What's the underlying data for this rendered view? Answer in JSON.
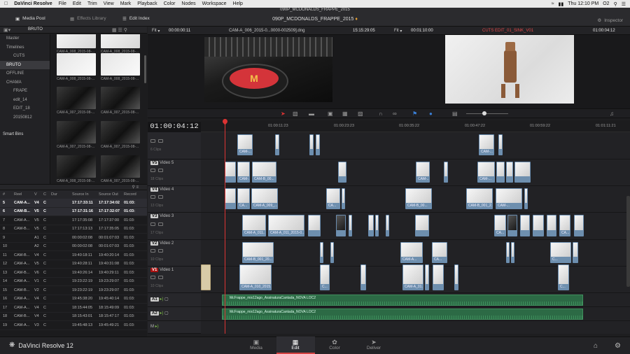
{
  "menubar": {
    "app": "DaVinci Resolve",
    "items": [
      "File",
      "Edit",
      "Trim",
      "View",
      "Mark",
      "Playback",
      "Color",
      "Nodes",
      "Workspace",
      "Help"
    ],
    "right": {
      "clock": "Thu 12:10 PM",
      "user": "O2"
    }
  },
  "window_title": "090P_MCDONALDS_FRAPPE_2015",
  "topbar": {
    "media_pool": "Media Pool",
    "effects_library": "Effects Library",
    "edit_index": "Edit Index",
    "project_title": "090P_MCDONALDS_FRAPPE_2015",
    "inspector": "Inspector",
    "bin_label": "BRUTO"
  },
  "bins": [
    {
      "label": "Master",
      "selected": false,
      "indent": false
    },
    {
      "label": "Timelines",
      "selected": false,
      "indent": false
    },
    {
      "label": "CUTS",
      "selected": false,
      "indent": true
    },
    {
      "label": "BRUTO",
      "selected": true,
      "indent": false
    },
    {
      "label": "OFFLINE",
      "selected": false,
      "indent": false
    },
    {
      "label": "CHAMA",
      "selected": false,
      "indent": false
    },
    {
      "label": "FRAPE",
      "selected": false,
      "indent": true
    },
    {
      "label": "edit_14",
      "selected": false,
      "indent": true
    },
    {
      "label": "EDIT_18",
      "selected": false,
      "indent": true
    },
    {
      "label": "20150812",
      "selected": false,
      "indent": true
    }
  ],
  "smart_bins": "Smart Bins",
  "thumbs": [
    {
      "caption": "CAM-A_008_2015-08-...",
      "style": "white"
    },
    {
      "caption": "CAM-A_008_2015-08-...",
      "style": "white"
    },
    {
      "caption": "CAM-A_008_2015-08-...",
      "style": "white2"
    },
    {
      "caption": "CAM-A_008_2015-08-...",
      "style": "white2"
    },
    {
      "caption": "CAM-A_007_2015-08-...",
      "style": "dj"
    },
    {
      "caption": "CAM-A_007_2015-08-...",
      "style": "dj"
    },
    {
      "caption": "CAM-A_007_2015-08-...",
      "style": "dj"
    },
    {
      "caption": "CAM-A_007_2015-08-...",
      "style": "dj"
    },
    {
      "caption": "CAM-A_008_2015-08-...",
      "style": "dj"
    },
    {
      "caption": "CAM-A_007_2015-08-...",
      "style": "dj"
    }
  ],
  "table": {
    "headers": [
      "#",
      "Reel",
      "V",
      "C",
      "Dur",
      "Source In",
      "Source Out",
      "Record"
    ],
    "rows": [
      [
        "5",
        "CAM-A...",
        "V4",
        "C",
        "",
        "17:17:33:11",
        "17:17:34:02",
        "01:03:",
        true
      ],
      [
        "6",
        "CAM-B...",
        "V5",
        "C",
        "",
        "17:17:31:16",
        "17:17:32:07",
        "01:03:",
        true
      ],
      [
        "7",
        "CAM-A...",
        "V5",
        "C",
        "",
        "17:17:35:08",
        "17:17:37:00",
        "01:03:",
        false
      ],
      [
        "8",
        "CAM-B...",
        "V5",
        "C",
        "",
        "17:17:13:13",
        "17:17:35:05",
        "01:03:",
        false
      ],
      [
        "9",
        "",
        "A1",
        "C",
        "",
        "00:00:02:08",
        "00:01:07:03",
        "01:03:",
        false
      ],
      [
        "10",
        "",
        "A2",
        "C",
        "",
        "00:00:02:08",
        "00:01:07:03",
        "01:03:",
        false
      ],
      [
        "11",
        "CAM-B...",
        "V4",
        "C",
        "",
        "19:40:18:11",
        "19:40:20:14",
        "01:03:",
        false
      ],
      [
        "12",
        "CAM-A...",
        "V5",
        "C",
        "",
        "19:40:28:11",
        "19:40:31:08",
        "01:03:",
        false
      ],
      [
        "13",
        "CAM-B...",
        "V6",
        "C",
        "",
        "19:40:26:14",
        "19:40:29:11",
        "01:03:",
        false
      ],
      [
        "14",
        "CAM-A...",
        "V1",
        "C",
        "",
        "19:23:22:19",
        "19:23:29:07",
        "01:03:",
        false
      ],
      [
        "15",
        "CAM-B...",
        "V2",
        "C",
        "",
        "19:23:22:19",
        "19:23:29:07",
        "01:03:",
        false
      ],
      [
        "16",
        "CAM-A...",
        "V4",
        "C",
        "",
        "19:45:38:20",
        "19:45:40:14",
        "01:03:",
        false
      ],
      [
        "17",
        "CAM-A...",
        "V4",
        "C",
        "",
        "18:15:44:05",
        "18:15:49:09",
        "01:03:",
        false
      ],
      [
        "18",
        "CAM-B...",
        "V4",
        "C",
        "",
        "18:15:43:01",
        "18:15:47:17",
        "01:03:",
        false
      ],
      [
        "19",
        "CAM-A...",
        "V3",
        "C",
        "",
        "19:45:48:13",
        "19:45:49:21",
        "01:03:",
        false
      ]
    ]
  },
  "source_viewer": {
    "fit": "Fit",
    "timecode_left": "00:00:00:11",
    "clip_name": "CAM-A_006_2015-0...0000-002509].dng",
    "timecode_right": "15:15:29:05"
  },
  "record_viewer": {
    "fit": "Fit",
    "timecode_left": "00:01:10:00",
    "timeline_name": "CUTS EDIT_01_SINK_V01",
    "timecode_right": "01:00:04:12"
  },
  "timeline": {
    "timecode": "01:00:04:12",
    "ruler": [
      "01:00:11:23",
      "01:00:23:23",
      "01:00:35:22",
      "01:00:47:22",
      "01:00:59:22",
      "01:01:11:21"
    ]
  },
  "tracks": {
    "v6": {
      "count": "6 Clips"
    },
    "v5": {
      "name": "Video 5",
      "badge": "V5",
      "count": "18 Clips"
    },
    "v4": {
      "name": "Video 4",
      "badge": "V4",
      "count": "13 Clips"
    },
    "v3": {
      "name": "Video 3",
      "badge": "V3",
      "count": "17 Clips"
    },
    "v2": {
      "name": "Video 2",
      "badge": "V2",
      "count": "10 Clips"
    },
    "v1": {
      "name": "Video 1",
      "badge": "V1",
      "count": "10 Clips"
    },
    "a1": {
      "badge": "A1"
    },
    "a2": {
      "badge": "A2"
    },
    "m": {
      "badge": "M"
    }
  },
  "clips": {
    "v5_labels": [
      "CAM-...",
      "CAM-B_00...",
      "CAM-...",
      "CAM-..."
    ],
    "v4_labels": [
      "CA...",
      "CAM-A_009_...",
      "CA...",
      "CAM-B_00...",
      "CAM-B_001_2...",
      "CAM-..."
    ],
    "v3_labels": [
      "CAM-A_011...",
      "CAM-A_011_2015-0...",
      "CA...",
      "CA..."
    ],
    "v2_labels": [
      "CAM-B_001_20...",
      "CAM-A...",
      "CA...",
      "C..."
    ],
    "v1_labels": [
      "CAM-A_010_2015...",
      "C...",
      "CAM-A_01...",
      "C..."
    ]
  },
  "audio": {
    "a1_clip": "McFrappe_mix12ago_AssinaturaCantada_NOVA LOC2",
    "a2_clip": "McFrappe_mix12ago_AssinaturaCantada_NOVA LOC2"
  },
  "bottom": {
    "brand": "DaVinci Resolve 12",
    "pages": [
      "Media",
      "Edit",
      "Color",
      "Deliver"
    ],
    "active": "Edit"
  },
  "colors": {
    "accent_red": "#d33",
    "audio_green": "#2c6a45",
    "clip_blue": "#6e8fae"
  }
}
